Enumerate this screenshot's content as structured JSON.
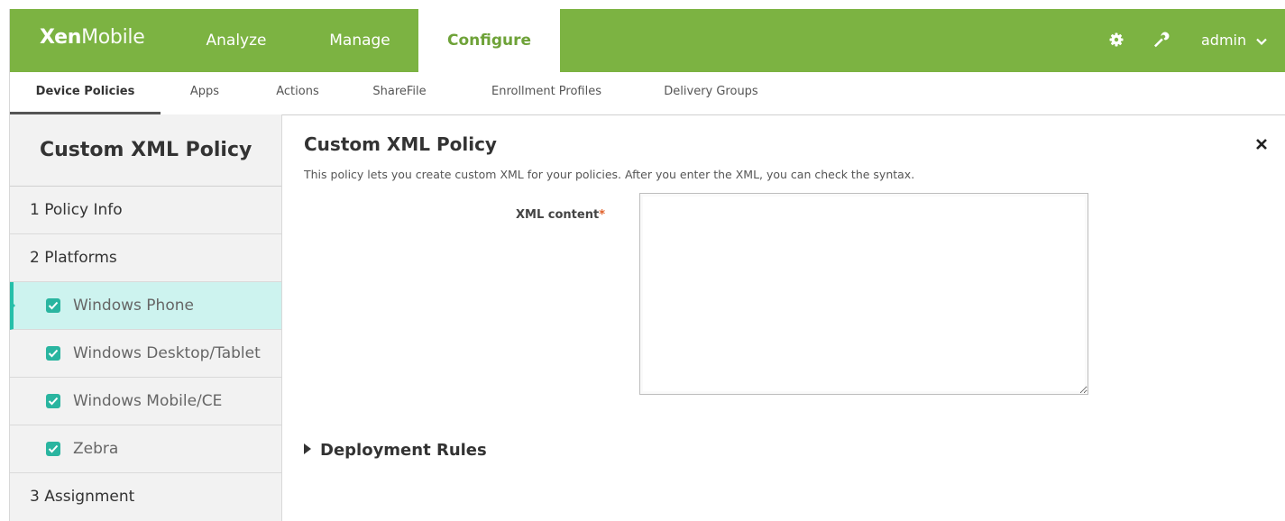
{
  "brand": {
    "bold": "Xen",
    "light": "Mobile"
  },
  "topnav": {
    "analyze": "Analyze",
    "manage": "Manage",
    "configure": "Configure",
    "user": "admin"
  },
  "subtabs": [
    "Device Policies",
    "Apps",
    "Actions",
    "ShareFile",
    "Enrollment Profiles",
    "Delivery Groups"
  ],
  "left": {
    "title": "Custom XML Policy",
    "step1": "1  Policy Info",
    "step2": "2  Platforms",
    "platforms": [
      "Windows Phone",
      "Windows Desktop/Tablet",
      "Windows Mobile/CE",
      "Zebra"
    ],
    "step3": "3  Assignment"
  },
  "main": {
    "title": "Custom XML Policy",
    "description": "This policy lets you create custom XML for your policies. After you enter the XML, you can check the syntax.",
    "xml_label": "XML content",
    "required_mark": "*",
    "xml_value": "",
    "deployment": "Deployment Rules"
  },
  "colors": {
    "accent": "#7cb342",
    "selected_bg": "#cdf3ef",
    "checkbox": "#2ab5a0"
  },
  "icons": {
    "settings": "gear-icon",
    "tools": "wrench-icon",
    "close": "close-icon"
  }
}
